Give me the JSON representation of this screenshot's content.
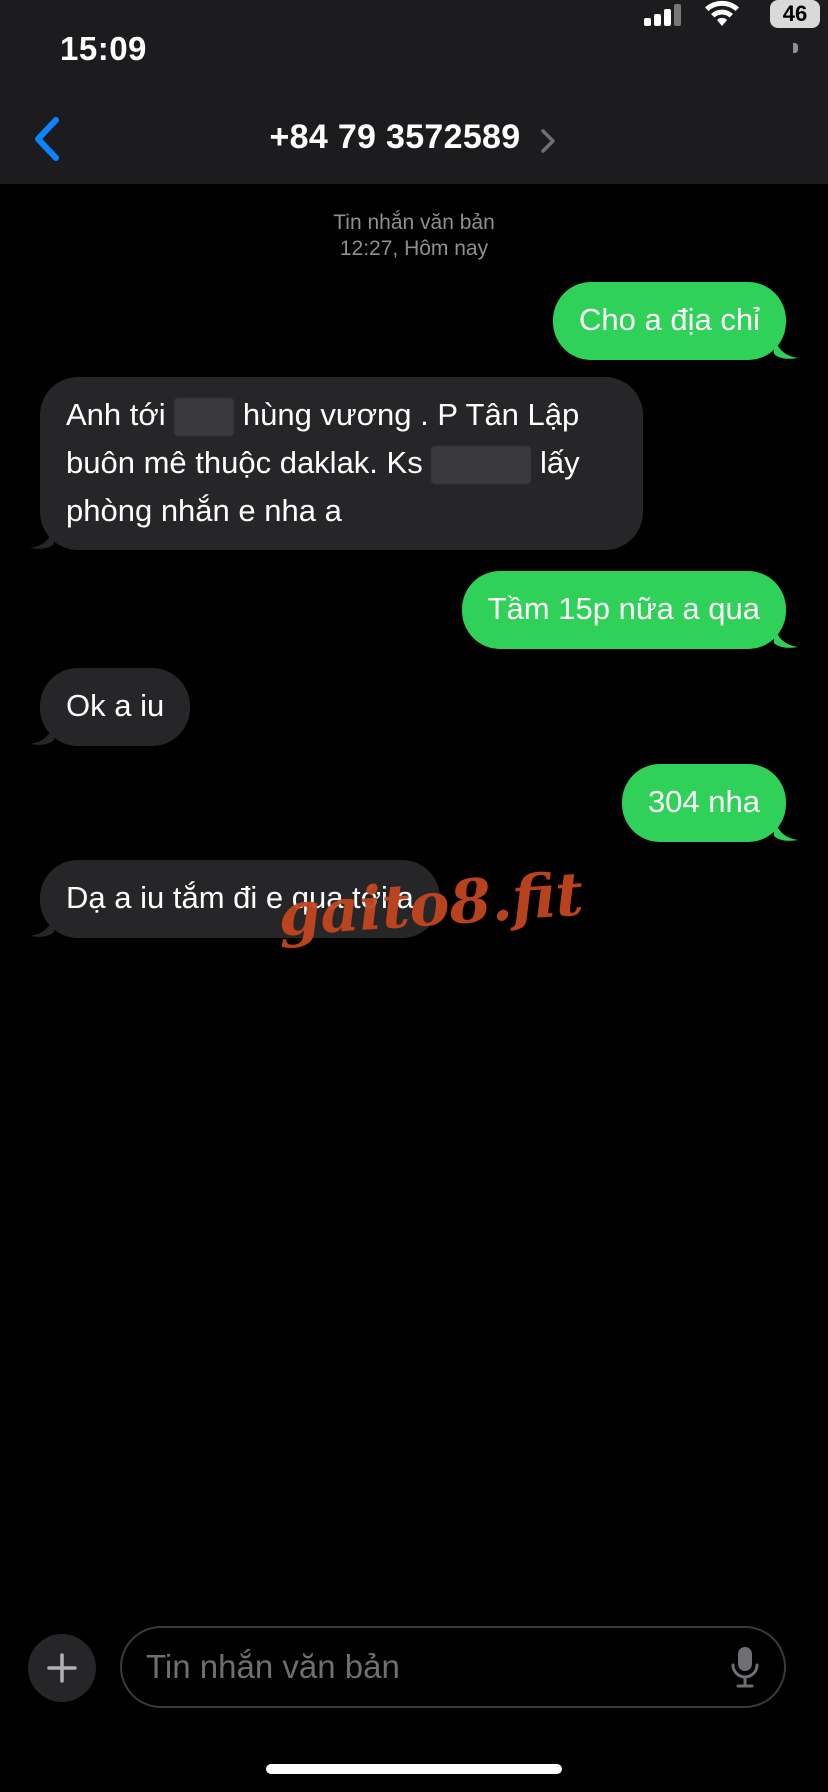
{
  "status_bar": {
    "time": "15:09",
    "battery": "46"
  },
  "header": {
    "title": "+84 79 3572589"
  },
  "thread": {
    "type_label": "Tin nhắn văn bản",
    "timestamp": "12:27, Hôm nay"
  },
  "messages": [
    {
      "from": "me",
      "text": "Cho a địa chỉ"
    },
    {
      "from": "them",
      "line1_a": "Anh tới",
      "line1_b": "hùng vương . P Tân Lập",
      "line2_a": "buôn mê thuộc daklak. Ks",
      "line2_b": "lấy",
      "line3": "phòng nhắn e nha a"
    },
    {
      "from": "me",
      "text": "Tầm 15p nữa a qua"
    },
    {
      "from": "them",
      "text": "Ok a iu"
    },
    {
      "from": "me",
      "text": "304 nha"
    },
    {
      "from": "them",
      "text": "Dạ a iu tắm đi e qua tới a"
    }
  ],
  "watermark": "gaito8.fit",
  "composer": {
    "placeholder": "Tin nhắn văn bản"
  },
  "colors": {
    "sent": "#30d158",
    "received": "#262628",
    "accent": "#0a84ff",
    "watermark": "#c1461f"
  }
}
